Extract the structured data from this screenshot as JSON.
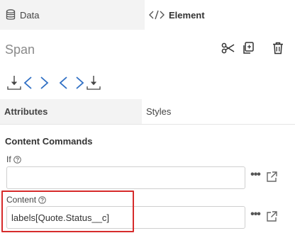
{
  "tabs": {
    "data_label": "Data",
    "element_label": "Element"
  },
  "element": {
    "name": "Span"
  },
  "subtabs": {
    "attributes_label": "Attributes",
    "styles_label": "Styles"
  },
  "section": {
    "title": "Content Commands"
  },
  "fields": {
    "if": {
      "label": "If",
      "value": ""
    },
    "content": {
      "label": "Content",
      "value": "labels[Quote.Status__c]"
    }
  },
  "more_label": "•••",
  "colors": {
    "accent": "#2f6fc4",
    "highlight": "#d62b2b",
    "tab_inactive_bg": "#f3f3f3"
  },
  "icons": [
    "database-icon",
    "code-icon",
    "scissors-icon",
    "copy-icon",
    "trash-icon",
    "insert-inside-icon",
    "insert-after-icon",
    "help-icon",
    "external-link-icon"
  ]
}
